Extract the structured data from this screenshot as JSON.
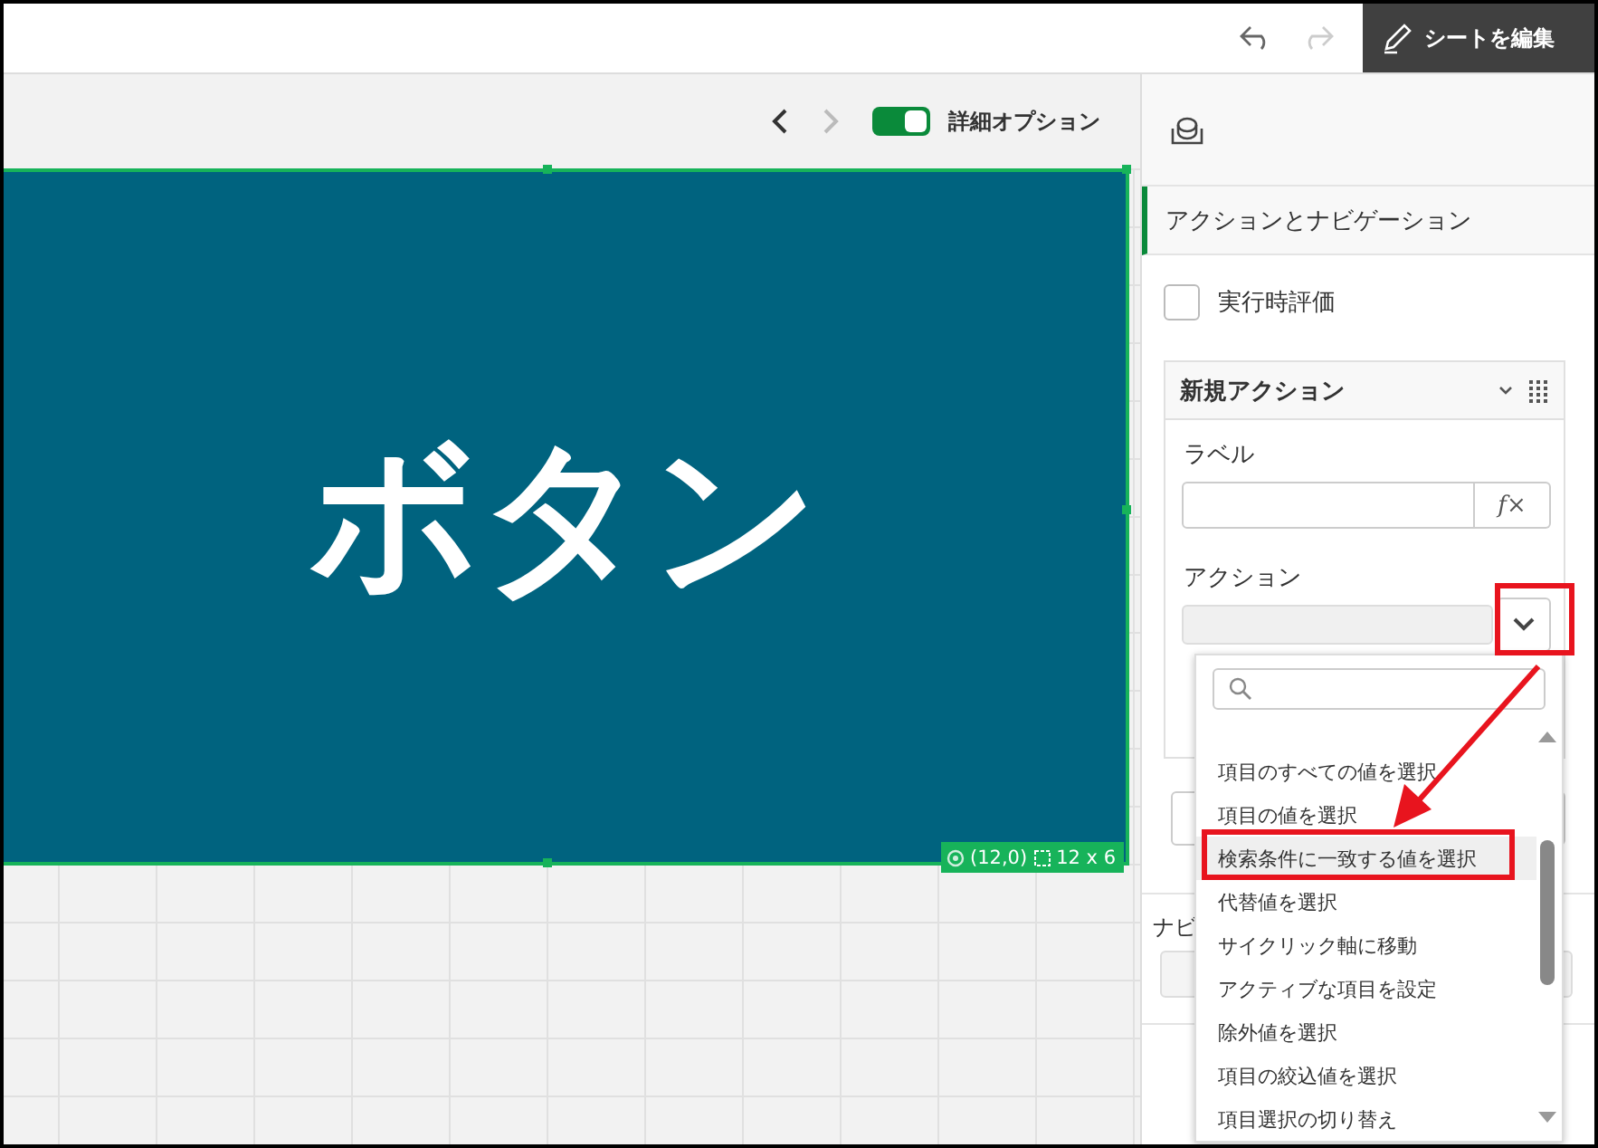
{
  "header": {
    "edit_button": "シートを編集"
  },
  "toolbar": {
    "toggle": {
      "label": "詳細オプション",
      "on": true
    }
  },
  "canvas": {
    "button_text": "ボタン",
    "position": "(12,0)",
    "size": "12 x 6"
  },
  "panel": {
    "section": "アクションとナビゲーション",
    "checkbox": {
      "label": "実行時評価",
      "checked": false
    },
    "action_card": {
      "title": "新規アクション",
      "label_field": "ラベル",
      "fx": "f×",
      "action_label": "アクション"
    },
    "navigation_label": "ナビ"
  },
  "dropdown": {
    "items": [
      {
        "label": "項目のすべての値を選択",
        "selected": false
      },
      {
        "label": "項目の値を選択",
        "selected": false
      },
      {
        "label": "検索条件に一致する値を選択",
        "selected": true
      },
      {
        "label": "代替値を選択",
        "selected": false
      },
      {
        "label": "サイクリック軸に移動",
        "selected": false
      },
      {
        "label": "アクティブな項目を設定",
        "selected": false
      },
      {
        "label": "除外値を選択",
        "selected": false
      },
      {
        "label": "項目の絞込値を選択",
        "selected": false
      },
      {
        "label": "項目選択の切り替え",
        "selected": false
      }
    ]
  }
}
